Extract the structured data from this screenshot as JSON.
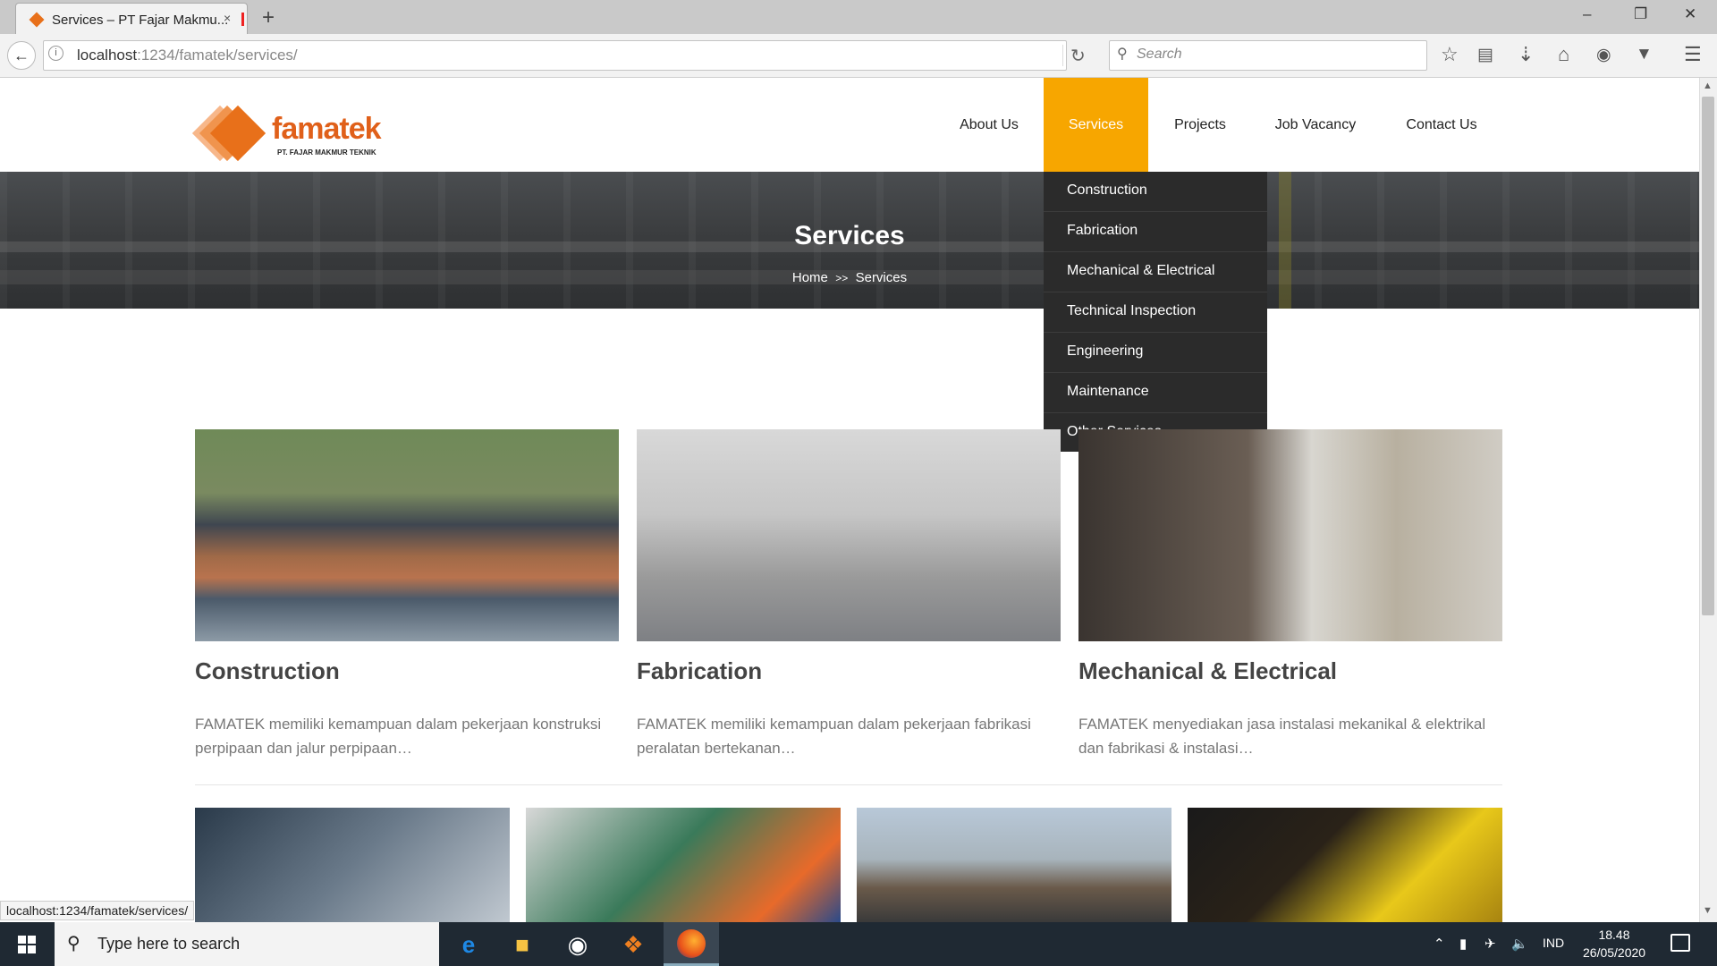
{
  "browser": {
    "tab_title": "Services – PT Fajar Makmu...",
    "tab_close": "×",
    "new_tab": "+",
    "url_host": "localhost",
    "url_rest": ":1234/famatek/services/",
    "search_placeholder": "Search",
    "status_url": "localhost:1234/famatek/services/",
    "window_min": "–",
    "window_restore": "❐",
    "window_close": "✕"
  },
  "site": {
    "logo_word": "famatek",
    "logo_sub": "PT. FAJAR MAKMUR TEKNIK",
    "nav": [
      "About Us",
      "Services",
      "Projects",
      "Job Vacancy",
      "Contact Us"
    ],
    "active_nav": "Services",
    "accent_color": "#f7a600"
  },
  "hero": {
    "title": "Services",
    "crumb_home": "Home",
    "crumb_sep": ">>",
    "crumb_current": "Services"
  },
  "dropdown": [
    "Construction",
    "Fabrication",
    "Mechanical & Electrical",
    "Technical Inspection",
    "Engineering",
    "Maintenance",
    "Other Services"
  ],
  "cards": [
    {
      "title": "Construction",
      "desc": "FAMATEK memiliki kemampuan dalam pekerjaan konstruksi perpipaan dan jalur perpipaan…"
    },
    {
      "title": "Fabrication",
      "desc": "FAMATEK memiliki kemampuan dalam pekerjaan fabrikasi peralatan bertekanan…"
    },
    {
      "title": "Mechanical & Electrical",
      "desc": "FAMATEK menyediakan jasa instalasi mekanikal & elektrikal dan fabrikasi & instalasi…"
    }
  ],
  "taskbar": {
    "search_text": "Type here to search",
    "lang": "IND",
    "time": "18.48",
    "date": "26/05/2020"
  }
}
